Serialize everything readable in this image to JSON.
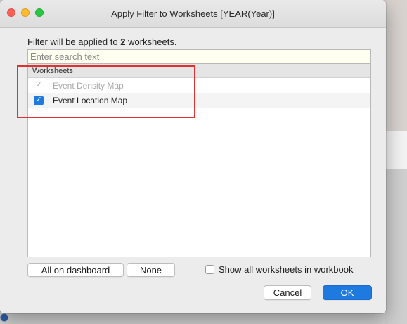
{
  "window": {
    "title": "Apply Filter to Worksheets [YEAR(Year)]"
  },
  "info": {
    "prefix": "Filter will be applied to ",
    "count": "2",
    "suffix": " worksheets."
  },
  "search": {
    "placeholder": "Enter search text",
    "value": ""
  },
  "list": {
    "header": "Worksheets",
    "rows": [
      {
        "label": "Event Density Map",
        "checked": true,
        "enabled": false
      },
      {
        "label": "Event Location Map",
        "checked": true,
        "enabled": true
      }
    ]
  },
  "buttons": {
    "all_on_dashboard": "All on dashboard",
    "none": "None",
    "cancel": "Cancel",
    "ok": "OK"
  },
  "show_all": {
    "label": "Show all worksheets in workbook",
    "checked": false
  },
  "colors": {
    "accent_blue": "#1f7ae0",
    "highlight_red": "#e03131",
    "search_bg": "#fffff0"
  },
  "icons": {
    "check": "check-icon"
  }
}
